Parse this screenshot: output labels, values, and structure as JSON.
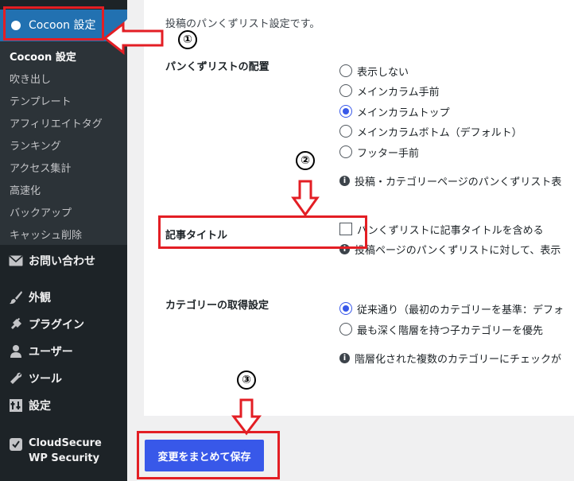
{
  "sidebar": {
    "active": "Cocoon 設定",
    "submenu": [
      "Cocoon 設定",
      "吹き出し",
      "テンプレート",
      "アフィリエイトタグ",
      "ランキング",
      "アクセス集計",
      "高速化",
      "バックアップ",
      "キャッシュ削除"
    ],
    "menu": [
      {
        "label": "お問い合わせ",
        "icon": "mail-icon"
      },
      {
        "label": "外観",
        "icon": "brush-icon"
      },
      {
        "label": "プラグイン",
        "icon": "plugin-icon"
      },
      {
        "label": "ユーザー",
        "icon": "user-icon"
      },
      {
        "label": "ツール",
        "icon": "wrench-icon"
      },
      {
        "label": "設定",
        "icon": "settings-icon"
      },
      {
        "label": "CloudSecure WP Security",
        "icon": "shield-check-icon"
      }
    ]
  },
  "panel": {
    "description": "投稿のパンくずリスト設定です。",
    "breadcrumb_position": {
      "label": "パンくずリストの配置",
      "options": [
        "表示しない",
        "メインカラム手前",
        "メインカラムトップ",
        "メインカラムボトム（デフォルト）",
        "フッター手前"
      ],
      "selected_index": 2,
      "info": "投稿・カテゴリーページのパンくずリスト表"
    },
    "article_title": {
      "label": "記事タイトル",
      "checkbox_label": "パンくずリストに記事タイトルを含める",
      "checked": false,
      "info": "投稿ページのパンくずリストに対して、表示"
    },
    "category_fetch": {
      "label": "カテゴリーの取得設定",
      "options": [
        "従来通り（最初のカテゴリーを基準：デフォ",
        "最も深く階層を持つ子カテゴリーを優先"
      ],
      "selected_index": 0,
      "info": "階層化された複数のカテゴリーにチェックが"
    }
  },
  "save_button": "変更をまとめて保存",
  "annotations": {
    "one": "①",
    "two": "②",
    "three": "③"
  },
  "colors": {
    "accent": "#3858e9",
    "sidebar": "#1d2327",
    "active": "#2271b1",
    "annotation": "#e31e24"
  }
}
